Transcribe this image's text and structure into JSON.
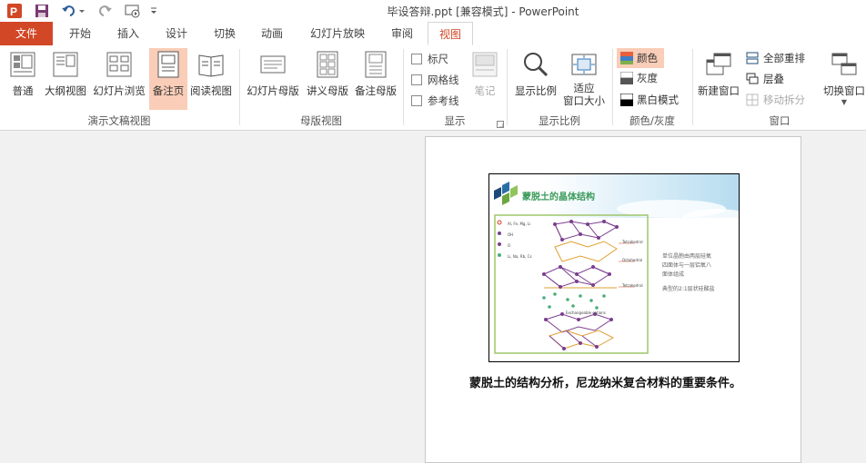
{
  "app": {
    "title": "毕设答辩.ppt [兼容模式] - PowerPoint",
    "accent": "#d24726"
  },
  "tabs": [
    "文件",
    "开始",
    "插入",
    "设计",
    "切换",
    "动画",
    "幻灯片放映",
    "审阅",
    "视图"
  ],
  "ribbon": {
    "presentation_views": {
      "label": "演示文稿视图",
      "buttons": [
        "普通",
        "大纲视图",
        "幻灯片浏览",
        "备注页",
        "阅读视图"
      ]
    },
    "master_views": {
      "label": "母版视图",
      "buttons": [
        "幻灯片母版",
        "讲义母版",
        "备注母版"
      ]
    },
    "show": {
      "label": "显示",
      "checkboxes": [
        "标尺",
        "网格线",
        "参考线"
      ],
      "notes_button": "笔记"
    },
    "zoom": {
      "label": "显示比例",
      "buttons": [
        "显示比例",
        "适应",
        "窗口大小"
      ]
    },
    "color": {
      "label": "颜色/灰度",
      "options": [
        "颜色",
        "灰度",
        "黑白模式"
      ]
    },
    "window": {
      "label": "窗口",
      "new_window": "新建窗口",
      "items": [
        "全部重排",
        "层叠",
        "移动拆分"
      ],
      "switch_window": "切换窗口"
    }
  },
  "slide": {
    "title": "蒙脱土的晶体结构",
    "legend": [
      "Al, Fe, Mg, Li",
      "OH",
      "O",
      "Li, Na, Rb, Cs"
    ],
    "annotations": [
      "Tetrahedral",
      "Octahedral",
      "Tetrahedral"
    ],
    "exchange_label": "Exchangeable cations",
    "text_line1": "单位晶胞由两层硅氧",
    "text_line2": "四面体与一层铝氧八",
    "text_line3": "面体组成",
    "text_line4": "典型的2:1层状硅酸盐"
  },
  "notes": {
    "text": "蒙脱土的结构分析，尼龙纳米复合材料的重要条件。"
  }
}
